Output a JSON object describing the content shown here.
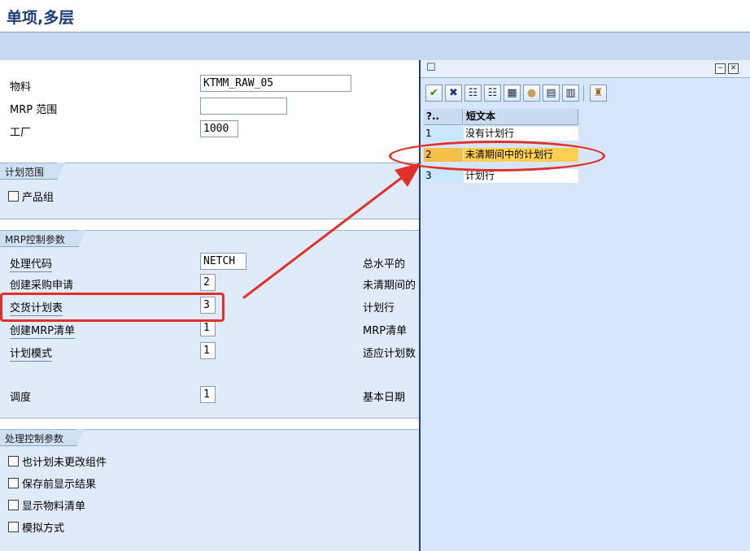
{
  "window": {
    "title": "单项,多层"
  },
  "header_fields": [
    {
      "label": "物料",
      "value": "KTMM_RAW_05"
    },
    {
      "label": "MRP 范围",
      "value": ""
    },
    {
      "label": "工厂",
      "value": "1000"
    }
  ],
  "planning_scope": {
    "tab_label": "计划范围",
    "product_group": {
      "label": "产品组",
      "checked": false
    }
  },
  "mrp_control": {
    "tab_label": "MRP控制参数",
    "rows": [
      {
        "label": "处理代码",
        "value": "NETCH",
        "right_text": "总水平的"
      },
      {
        "label": "创建采购申请",
        "value": "2",
        "right_text": "未清期间的"
      },
      {
        "label": "交货计划表",
        "value": "3",
        "right_text": "计划行"
      },
      {
        "label": "创建MRP清单",
        "value": "1",
        "right_text": "MRP清单"
      },
      {
        "label": "计划模式",
        "value": "1",
        "right_text": "适应计划数"
      },
      {
        "label": "调度",
        "value": "1",
        "right_text": "基本日期"
      }
    ]
  },
  "process_control": {
    "tab_label": "处理控制参数",
    "options": [
      {
        "label": "也计划未更改组件",
        "checked": false
      },
      {
        "label": "保存前显示结果",
        "checked": false
      },
      {
        "label": "显示物料清单",
        "checked": false
      },
      {
        "label": "模拟方式",
        "checked": false
      }
    ]
  },
  "popup": {
    "title_icon": "document-icon",
    "window_buttons": [
      "minimize-icon",
      "close-icon"
    ],
    "toolbar_icons": [
      "checkmark-icon",
      "cancel-icon",
      "find-icon",
      "find-next-icon",
      "sort-icon",
      "info-icon",
      "print-icon",
      "details-icon",
      "favorites-icon"
    ],
    "columns": [
      "?..",
      "短文本"
    ],
    "items": [
      {
        "key": "1",
        "text": "没有计划行"
      },
      {
        "key": "2",
        "text": "未清期间中的计划行",
        "selected": true
      },
      {
        "key": "3",
        "text": "计划行"
      }
    ]
  },
  "colors": {
    "highlight": "#e0302a",
    "selection": "#ffcf52",
    "toolbar": "#c5dbf1",
    "title": "#1c3e78"
  }
}
